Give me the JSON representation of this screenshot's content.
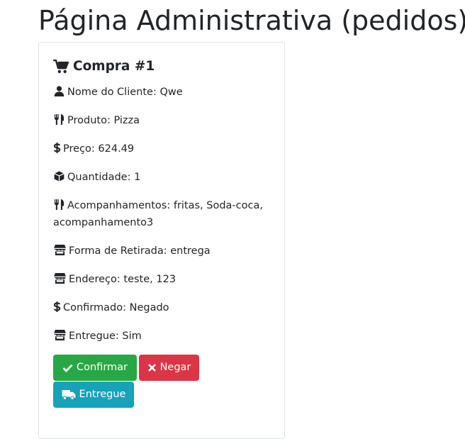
{
  "page_title": "Página Administrativa (pedidos)",
  "order": {
    "title": "Compra #1",
    "fields": [
      {
        "icon": "user-icon",
        "text": "Nome do Cliente: Qwe"
      },
      {
        "icon": "utensils-icon",
        "text": "Produto: Pizza"
      },
      {
        "icon": "dollar-icon",
        "text": "Preço: 624.49"
      },
      {
        "icon": "box-icon",
        "text": "Quantidade: 1"
      },
      {
        "icon": "utensils-icon",
        "text": "Acompanhamentos: fritas, Soda-coca, acompanhamento3"
      },
      {
        "icon": "store-icon",
        "text": "Forma de Retirada: entrega"
      },
      {
        "icon": "store-icon",
        "text": "Endereço: teste, 123"
      },
      {
        "icon": "dollar-icon",
        "text": "Confirmado: Negado"
      },
      {
        "icon": "store-icon",
        "text": "Entregue: Sim"
      }
    ]
  },
  "actions": {
    "confirm_label": "Confirmar",
    "deny_label": "Negar",
    "delivered_label": "Entregue"
  },
  "colors": {
    "success": "#28a745",
    "danger": "#dc3545",
    "info": "#17a2b8",
    "text": "#212529"
  }
}
